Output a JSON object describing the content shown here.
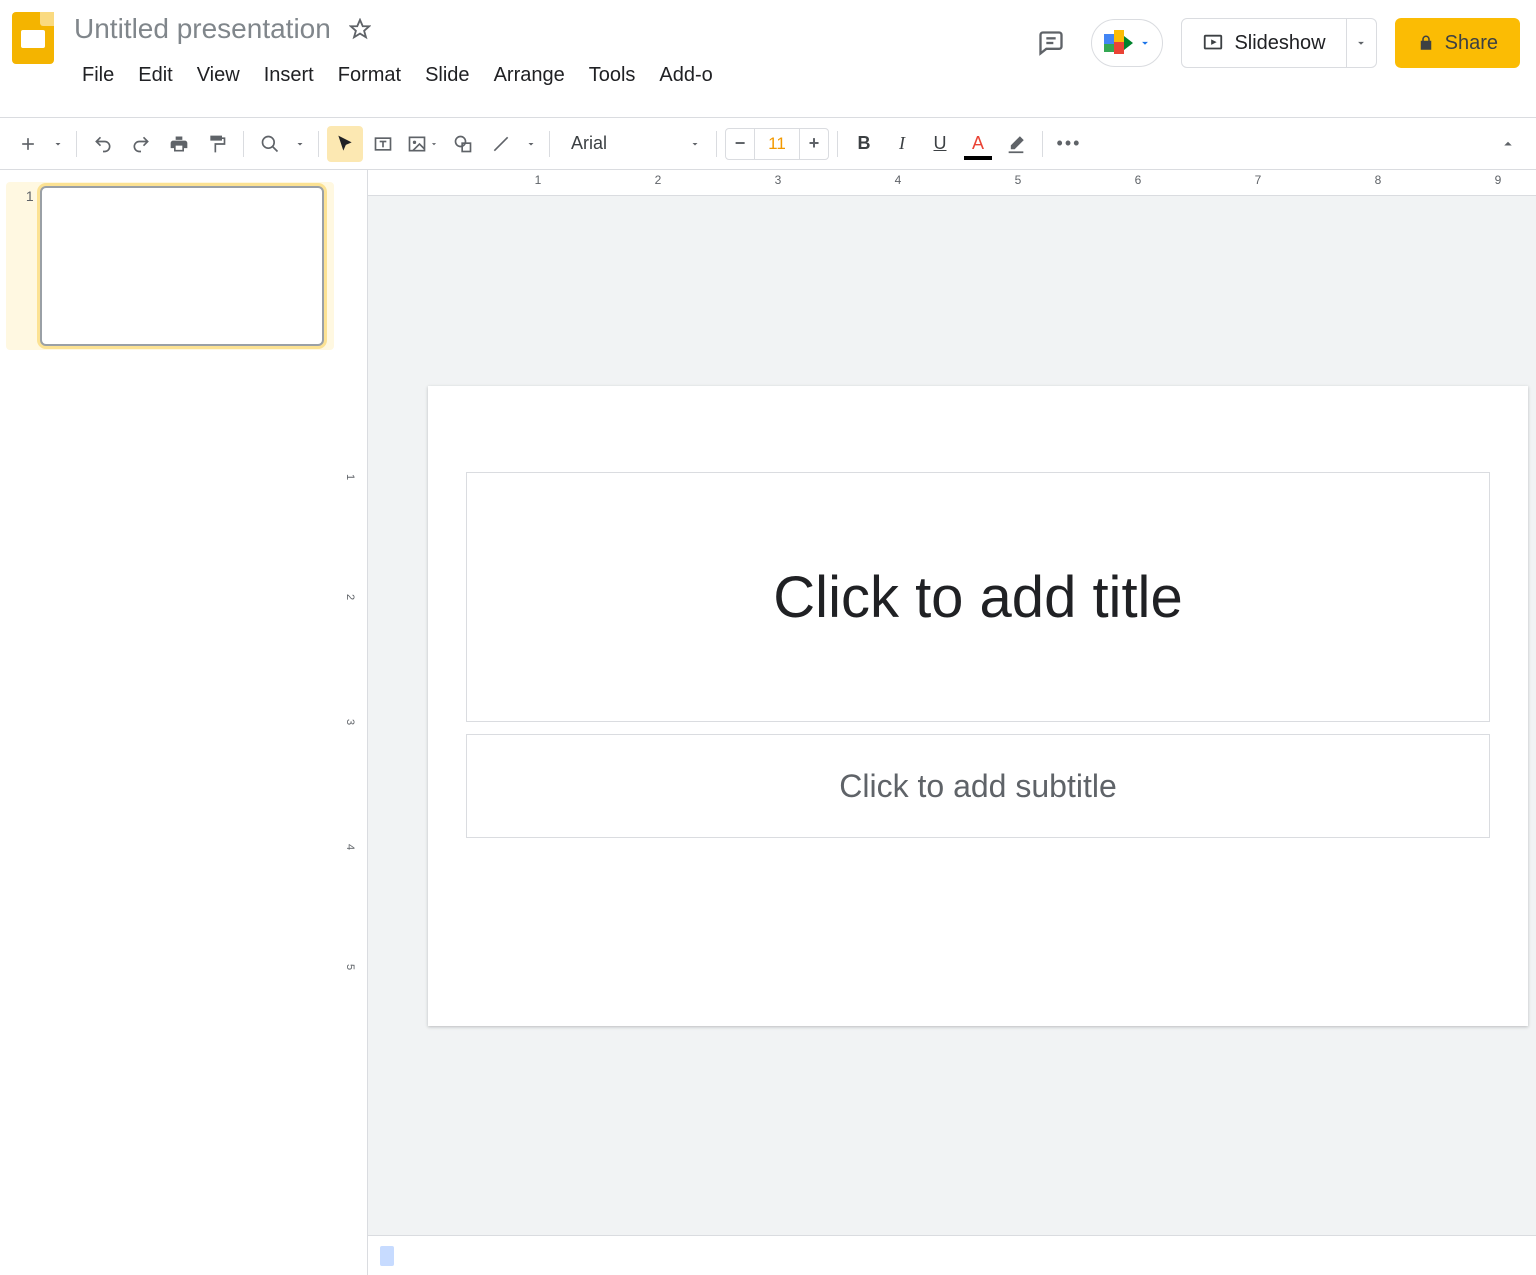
{
  "header": {
    "doc_title": "Untitled presentation",
    "slideshow_label": "Slideshow",
    "share_label": "Share"
  },
  "menus": [
    "File",
    "Edit",
    "View",
    "Insert",
    "Format",
    "Slide",
    "Arrange",
    "Tools",
    "Add-o"
  ],
  "toolbar": {
    "font_name": "Arial",
    "font_size": "11"
  },
  "ruler_h": [
    "1",
    "2",
    "3",
    "4",
    "5",
    "6",
    "7",
    "8",
    "9"
  ],
  "ruler_v": [
    "1",
    "2",
    "3",
    "4",
    "5"
  ],
  "thumbnails": [
    {
      "number": "1"
    }
  ],
  "slide": {
    "title_placeholder": "Click to add title",
    "subtitle_placeholder": "Click to add subtitle"
  },
  "icons": {
    "minus": "−",
    "plus": "+"
  }
}
